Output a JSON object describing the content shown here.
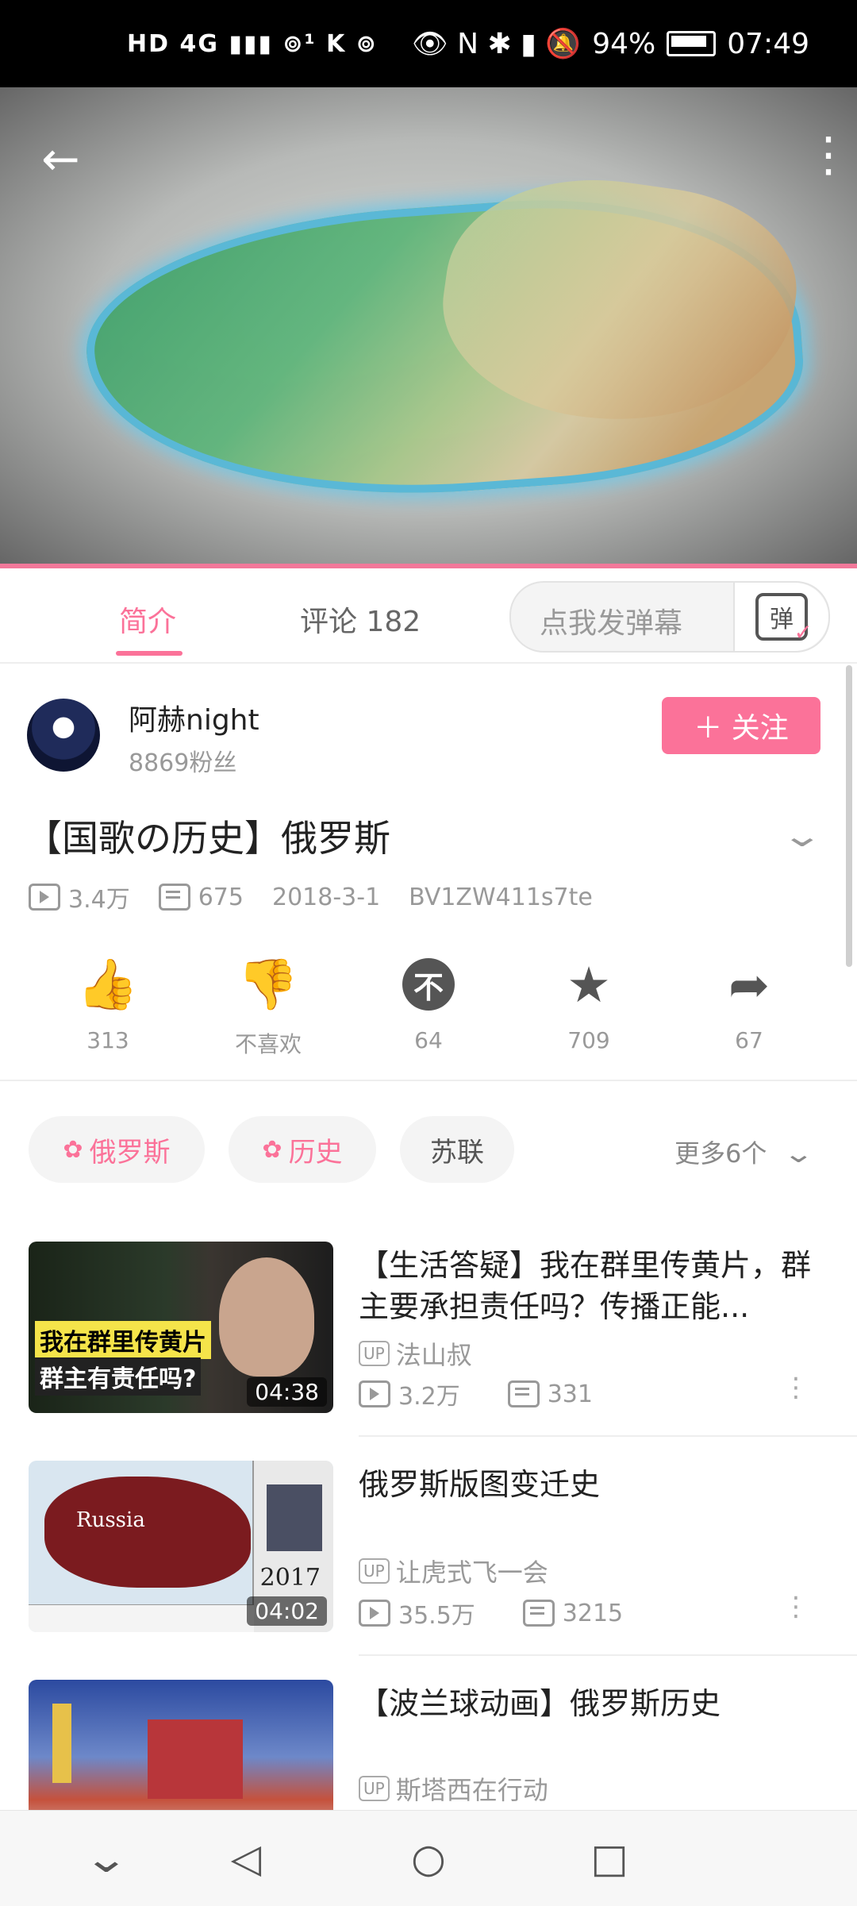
{
  "status_bar": {
    "left_icons": "HD 4G ▮▮▮ ⊚¹ K ⊚",
    "right_icons": "👁 N ✱ ▮ 🔕",
    "battery": "94%",
    "time": "07:49"
  },
  "video": {
    "back_icon": "arrow-left",
    "more_icon": "vertical-dots"
  },
  "tabs": {
    "intro": "简介",
    "comments": "评论 182",
    "danmaku_placeholder": "点我发弹幕",
    "danmaku_icon_text": "弹"
  },
  "uploader": {
    "name": "阿赫night",
    "fans": "8869粉丝",
    "follow_label": "＋ 关注"
  },
  "video_info": {
    "title": "【国歌の历史】俄罗斯",
    "views": "3.4万",
    "danmaku_count": "675",
    "date": "2018-3-1",
    "bvid": "BV1ZW411s7te"
  },
  "actions": {
    "like": "313",
    "dislike": "不喜欢",
    "coin": "64",
    "favorite": "709",
    "share": "67"
  },
  "tags": [
    {
      "label": "俄罗斯"
    },
    {
      "label": "历史"
    },
    {
      "label": "苏联"
    }
  ],
  "more_tags": "更多6个",
  "related": [
    {
      "title": "【生活答疑】我在群里传黄片，群主要承担责任吗？传播正能...",
      "up": "法山叔",
      "views": "3.2万",
      "danmaku": "331",
      "duration": "04:38",
      "thumb_text1": "我在群里传黄片",
      "thumb_text2": "群主有责任吗?"
    },
    {
      "title": "俄罗斯版图变迁史",
      "up": "让虎式飞一会",
      "views": "35.5万",
      "danmaku": "3215",
      "duration": "04:02",
      "thumb_text1": "Russia",
      "thumb_text2": "2017"
    },
    {
      "title": "【波兰球动画】俄罗斯历史",
      "up": "斯塔西在行动"
    }
  ],
  "up_badge": "UP"
}
